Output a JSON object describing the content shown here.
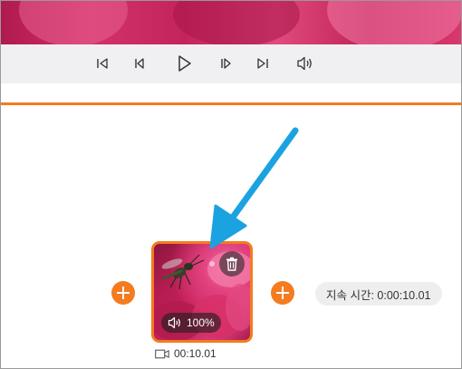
{
  "preview": {
    "description_colors": {
      "accent": "#d2316b"
    }
  },
  "controls": {
    "items": [
      {
        "name": "skip-to-start-icon"
      },
      {
        "name": "previous-frame-icon"
      },
      {
        "name": "play-icon"
      },
      {
        "name": "next-frame-icon"
      },
      {
        "name": "skip-to-end-icon"
      },
      {
        "name": "volume-icon"
      }
    ]
  },
  "timeline": {
    "accent_color": "#f47b20",
    "clip": {
      "volume": "100%",
      "duration": "00:10.01",
      "icons": [
        "trash-icon",
        "volume-icon",
        "video-camera-icon"
      ]
    },
    "duration_label": "지속 시간: 0:00:10.01"
  },
  "annotation": {
    "arrow_color": "#1aa3e0"
  }
}
